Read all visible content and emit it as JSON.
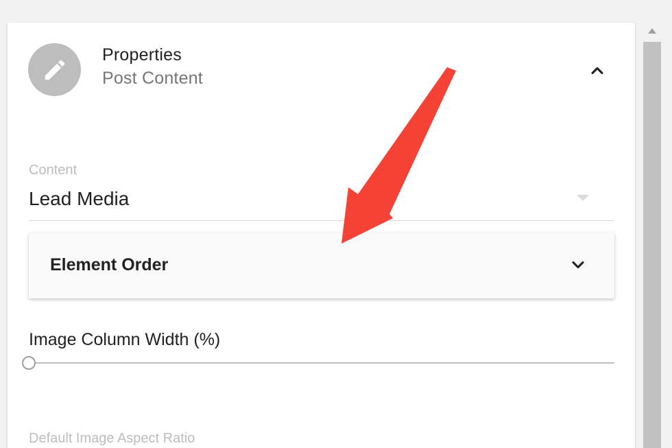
{
  "header": {
    "title": "Properties",
    "subtitle": "Post Content"
  },
  "content_select": {
    "label": "Content",
    "value": "Lead Media"
  },
  "element_order": {
    "title": "Element Order"
  },
  "image_column_width": {
    "label": "Image Column Width (%)",
    "value_fraction": 0
  },
  "aspect_ratio": {
    "label": "Default Image Aspect Ratio"
  },
  "colors": {
    "avatar_bg": "#bdbdbd",
    "annotation_arrow": "#f44336",
    "panel_bg": "#ffffff",
    "page_bg": "#f2f2f2"
  },
  "icons": {
    "avatar": "pencil-icon",
    "collapse": "chevron-up-icon",
    "select_caret": "caret-down-icon",
    "accordion": "chevron-down-icon",
    "scroll_up": "arrow-up-icon"
  }
}
